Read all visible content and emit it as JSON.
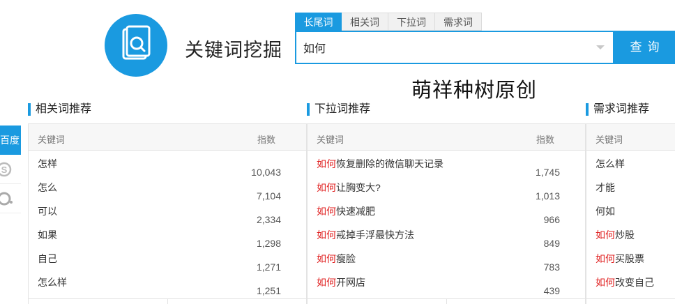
{
  "app": {
    "title": "关键词挖掘",
    "logo_icon": "document-search-icon"
  },
  "search": {
    "tabs": [
      {
        "label": "长尾词",
        "active": true
      },
      {
        "label": "相关词",
        "active": false
      },
      {
        "label": "下拉词",
        "active": false
      },
      {
        "label": "需求词",
        "active": false
      }
    ],
    "value": "如何",
    "button_label": "查询"
  },
  "watermark": "萌祥种树原创",
  "sidebar": {
    "baidu_label": "百度",
    "icons": [
      "sogou-icon",
      "360-icon"
    ]
  },
  "columns": {
    "keyword": "关键词",
    "index": "指数"
  },
  "panels": [
    {
      "title": "相关词推荐",
      "rows": [
        {
          "highlight": "",
          "rest": "怎样",
          "index": "10,043"
        },
        {
          "highlight": "",
          "rest": "怎么",
          "index": "7,104"
        },
        {
          "highlight": "",
          "rest": "可以",
          "index": "2,334"
        },
        {
          "highlight": "",
          "rest": "如果",
          "index": "1,298"
        },
        {
          "highlight": "",
          "rest": "自己",
          "index": "1,271"
        },
        {
          "highlight": "",
          "rest": "怎么样",
          "index": "1,251"
        }
      ]
    },
    {
      "title": "下拉词推荐",
      "rows": [
        {
          "highlight": "如何",
          "rest": "恢复删除的微信聊天记录",
          "index": "1,745"
        },
        {
          "highlight": "如何",
          "rest": "让胸变大?",
          "index": "1,013"
        },
        {
          "highlight": "如何",
          "rest": "快速减肥",
          "index": "966"
        },
        {
          "highlight": "如何",
          "rest": "戒掉手浮最快方法",
          "index": "849"
        },
        {
          "highlight": "如何",
          "rest": "瘦脸",
          "index": "783"
        },
        {
          "highlight": "如何",
          "rest": "开网店",
          "index": "439"
        }
      ]
    },
    {
      "title": "需求词推荐",
      "rows": [
        {
          "highlight": "",
          "rest": "怎么样"
        },
        {
          "highlight": "",
          "rest": "才能"
        },
        {
          "highlight": "",
          "rest": "何如"
        },
        {
          "highlight": "如何",
          "rest": "炒股"
        },
        {
          "highlight": "如何",
          "rest": "买股票"
        },
        {
          "highlight": "如何",
          "rest": "改变自己"
        }
      ]
    }
  ]
}
